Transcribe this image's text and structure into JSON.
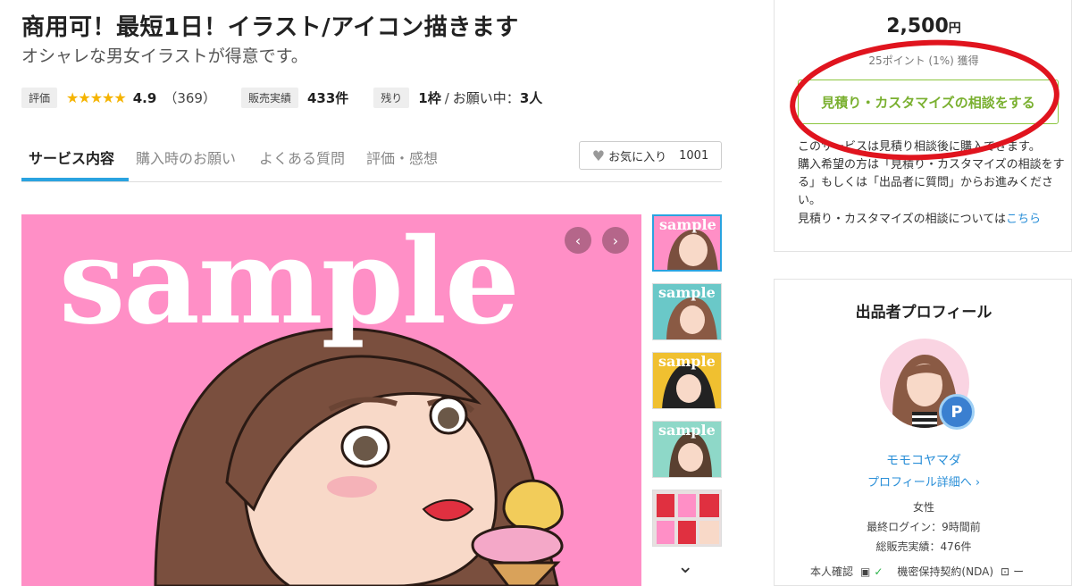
{
  "service": {
    "title": "商用可！最短1日！イラスト/アイコン描きます",
    "subtitle": "オシャレな男女イラストが得意です。"
  },
  "meta": {
    "rating_label": "評価",
    "stars": "★★★★★",
    "rating": "4.9",
    "review_count": "（369）",
    "sales_label": "販売実績",
    "sales_value": "433件",
    "remaining_label": "残り",
    "remaining_value": "1枠",
    "in_progress_label": "お願い中：",
    "in_progress_value": "3人"
  },
  "tabs": [
    {
      "label": "サービス内容"
    },
    {
      "label": "購入時のお願い"
    },
    {
      "label": "よくある質問"
    },
    {
      "label": "評価・感想"
    }
  ],
  "favorite": {
    "label": "お気に入り",
    "count": "1001"
  },
  "gallery": {
    "watermark": "sample",
    "thumb_watermark": "sample",
    "thumb_colors": [
      "#ff8fc6",
      "#6ac8c8",
      "#f0c030",
      "#8ed8c8",
      "#e8e0e0"
    ]
  },
  "purchase": {
    "price": "2,500",
    "price_unit": "円",
    "points": "25ポイント (1%) 獲得",
    "consult_button": "見積り・カスタマイズの相談をする",
    "desc_1": "このサービスは見積り相談後に購入できます。",
    "desc_2": "購入希望の方は「見積り・カスタマイズの相談をする」もしくは「出品者に質問」からお進みください。",
    "desc_3": "見積り・カスタマイズの相談については",
    "desc_link": "こちら"
  },
  "profile": {
    "heading": "出品者プロフィール",
    "badge": "P",
    "name": "モモコヤマダ",
    "detail_link": "プロフィール詳細へ ›",
    "gender": "女性",
    "last_login": "最終ログイン：9時間前",
    "total_sales": "総販売実績：476件",
    "identity_label": "本人確認",
    "nda_label": "機密保持契約(NDA)",
    "nda_value": "ー"
  },
  "colors": {
    "accent_blue": "#2aa3e0",
    "consult_green": "#7ab030",
    "annotation_red": "#e0141e",
    "image_pink": "#ff8fc6"
  }
}
